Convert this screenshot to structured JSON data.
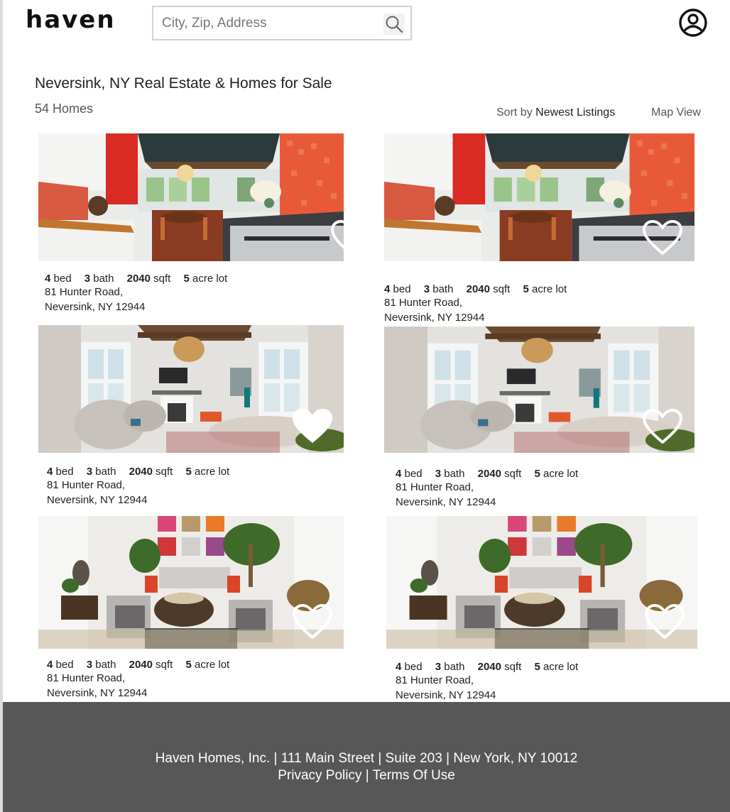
{
  "header": {
    "logo": "haven",
    "search_placeholder": "City, Zip, Address"
  },
  "page": {
    "title": "Neversink, NY Real Estate & Homes for Sale",
    "count": "54 Homes",
    "sort_label": "Sort by",
    "sort_value": "Newest Listings",
    "map_view": "Map View"
  },
  "listings": [
    {
      "beds": "4",
      "beds_label": "bed",
      "baths": "3",
      "baths_label": "bath",
      "sqft": "2040",
      "sqft_label": "sqft",
      "lot": "5",
      "lot_label": "acre lot",
      "address1": "81 Hunter Road,",
      "address2": "Neversink, NY 12944",
      "favorited": false,
      "photo": "kitchen"
    },
    {
      "beds": "4",
      "beds_label": "bed",
      "baths": "3",
      "baths_label": "bath",
      "sqft": "2040",
      "sqft_label": "sqft",
      "lot": "5",
      "lot_label": "acre lot",
      "address1": "81 Hunter Road,",
      "address2": "Neversink, NY 12944",
      "favorited": false,
      "photo": "kitchen"
    },
    {
      "beds": "4",
      "beds_label": "bed",
      "baths": "3",
      "baths_label": "bath",
      "sqft": "2040",
      "sqft_label": "sqft",
      "lot": "5",
      "lot_label": "acre lot",
      "address1": "81 Hunter Road,",
      "address2": "Neversink, NY 12944",
      "favorited": true,
      "photo": "living-room"
    },
    {
      "beds": "4",
      "beds_label": "bed",
      "baths": "3",
      "baths_label": "bath",
      "sqft": "2040",
      "sqft_label": "sqft",
      "lot": "5",
      "lot_label": "acre lot",
      "address1": "81 Hunter Road,",
      "address2": "Neversink, NY 12944",
      "favorited": false,
      "photo": "living-room"
    },
    {
      "beds": "4",
      "beds_label": "bed",
      "baths": "3",
      "baths_label": "bath",
      "sqft": "2040",
      "sqft_label": "sqft",
      "lot": "5",
      "lot_label": "acre lot",
      "address1": "81 Hunter Road,",
      "address2": "Neversink, NY 12944",
      "favorited": false,
      "photo": "lounge"
    },
    {
      "beds": "4",
      "beds_label": "bed",
      "baths": "3",
      "baths_label": "bath",
      "sqft": "2040",
      "sqft_label": "sqft",
      "lot": "5",
      "lot_label": "acre lot",
      "address1": "81 Hunter Road,",
      "address2": "Neversink, NY 12944",
      "favorited": false,
      "photo": "lounge"
    }
  ],
  "footer": {
    "line1": "Haven Homes, Inc. | 111 Main Street | Suite 203 | New York, NY 10012",
    "privacy": "Privacy Policy",
    "separator": "|",
    "terms": "Terms Of Use"
  },
  "colors": {
    "footer_bg": "#575757",
    "text": "#222222"
  }
}
